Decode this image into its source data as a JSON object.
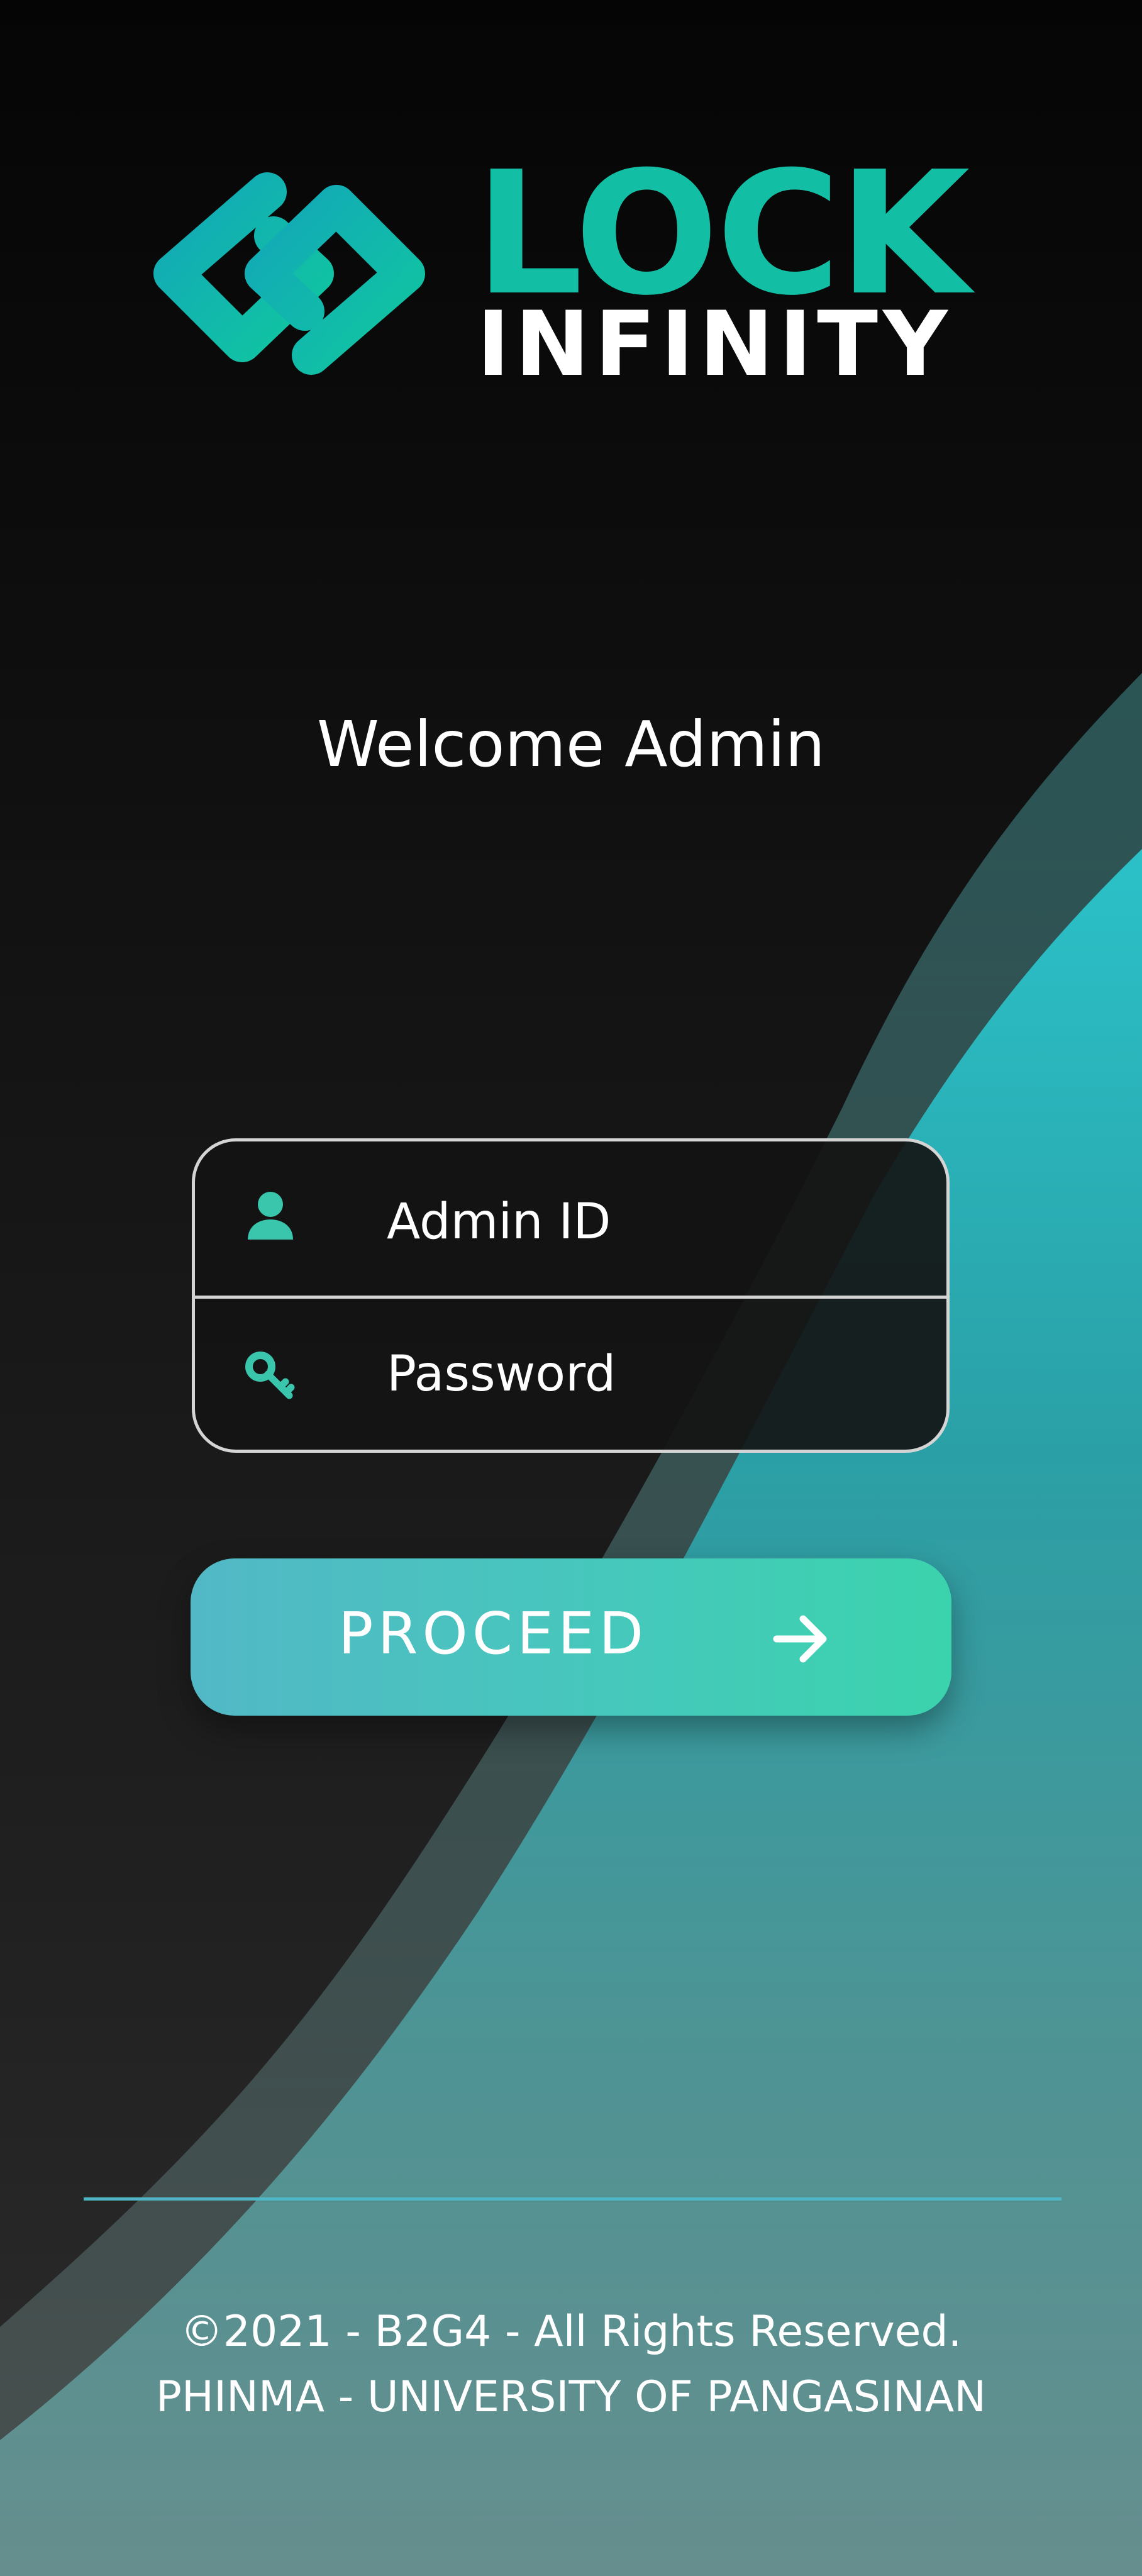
{
  "brand": {
    "name_line_1": "LOCK",
    "name_line_2": "INFINITY",
    "logo_icon": "infinity-lock-logo-icon",
    "accent_color": "#12bfa5"
  },
  "welcome": {
    "title": "Welcome Admin"
  },
  "login_form": {
    "admin_id": {
      "icon": "user-icon",
      "placeholder": "Admin ID",
      "value": ""
    },
    "password": {
      "icon": "key-icon",
      "placeholder": "Password",
      "value": ""
    }
  },
  "proceed_button": {
    "label": "PROCEED",
    "icon": "arrow-right-icon"
  },
  "footer": {
    "copyright": "©2021 - B2G4 - All Rights Reserved.",
    "institution": "PHINMA - UNIVERSITY OF PANGASINAN"
  },
  "colors": {
    "background": "#121212",
    "wave": "#2bbdc3",
    "button_start": "#52b8c6",
    "button_end": "#3bd3ad",
    "field_border": "#d4d4d4"
  }
}
